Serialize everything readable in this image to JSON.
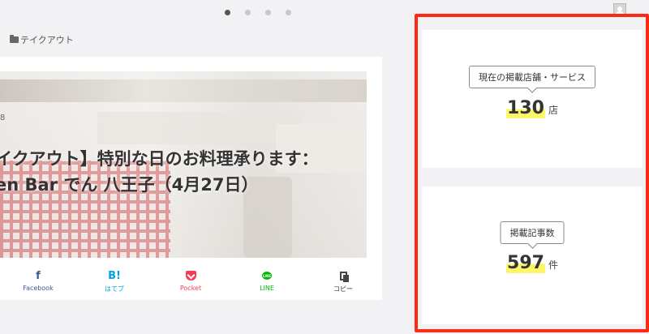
{
  "carousel": {
    "dots": 4,
    "active_index": 0
  },
  "category": {
    "label": "テイクアウト"
  },
  "article": {
    "date_fragment": "8",
    "title_line1": "イクアウト】特別な日のお料理承ります：",
    "title_line2": "en Bar でん 八王子（4月27日）"
  },
  "share": {
    "facebook": {
      "icon": "f",
      "label": "Facebook"
    },
    "hatena": {
      "icon": "B!",
      "label": "はてブ"
    },
    "pocket": {
      "label": "Pocket"
    },
    "line": {
      "icon": "LINE",
      "label": "LINE"
    },
    "copy": {
      "label": "コピー"
    }
  },
  "stats": {
    "shops": {
      "label": "現在の掲載店舗・サービス",
      "value": "130",
      "unit": "店"
    },
    "articles": {
      "label": "掲載記事数",
      "value": "597",
      "unit": "件"
    }
  },
  "colors": {
    "highlight": "#ff2a14",
    "marker": "#fdf56a",
    "facebook": "#3b5998",
    "hatena": "#00a4de",
    "pocket": "#ef3f56",
    "line": "#00b900"
  }
}
